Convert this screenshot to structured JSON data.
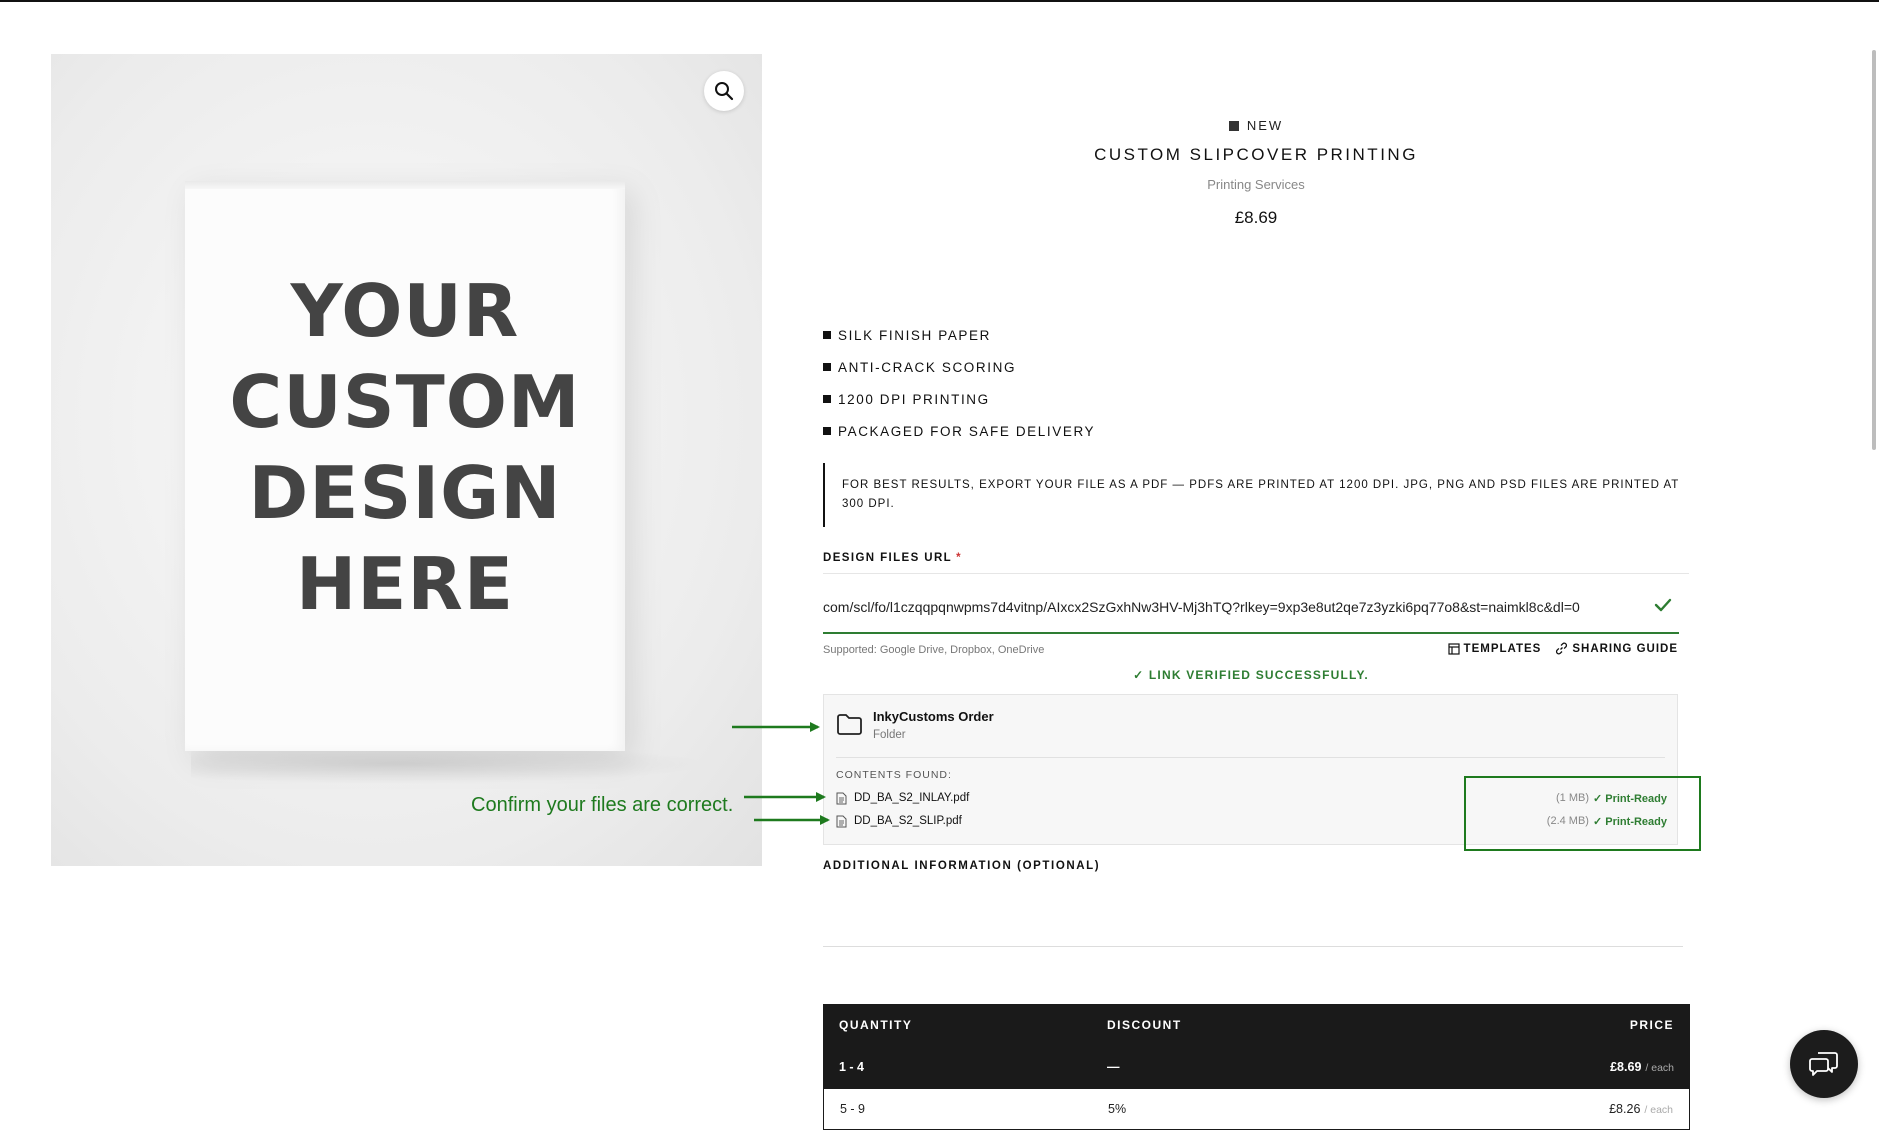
{
  "product": {
    "badge": "NEW",
    "title": "CUSTOM SLIPCOVER PRINTING",
    "category": "Printing Services",
    "price": "£8.69",
    "image_text": [
      "YOUR",
      "CUSTOM",
      "DESIGN",
      "HERE"
    ],
    "features": [
      "SILK FINISH PAPER",
      "ANTI-CRACK SCORING",
      "1200 DPI PRINTING",
      "PACKAGED FOR SAFE DELIVERY"
    ],
    "note": "FOR BEST RESULTS, EXPORT YOUR FILE AS A PDF — PDFS ARE PRINTED AT 1200 DPI. JPG, PNG AND PSD FILES ARE PRINTED AT 300 DPI."
  },
  "design_files": {
    "label": "DESIGN FILES URL",
    "required_mark": "*",
    "value": "com/scl/fo/l1czqqpqnwpms7d4vitnp/AIxcx2SzGxhNw3HV-Mj3hTQ?rlkey=9xp3e8ut2qe7z3yzki6pq77o8&st=naimkl8c&dl=0",
    "supported": "Supported: Google Drive, Dropbox, OneDrive",
    "templates_label": "TEMPLATES",
    "sharing_label": "SHARING GUIDE",
    "verified": "✓ LINK VERIFIED SUCCESSFULLY."
  },
  "folder": {
    "name": "InkyCustoms Order",
    "type": "Folder",
    "contents_label": "CONTENTS FOUND:",
    "files": [
      {
        "name": "DD_BA_S2_INLAY.pdf",
        "size": "(1 MB)",
        "status": "✓ Print-Ready"
      },
      {
        "name": "DD_BA_S2_SLIP.pdf",
        "size": "(2.4 MB)",
        "status": "✓ Print-Ready"
      }
    ]
  },
  "annotation": {
    "text": "Confirm your files are correct.",
    "color": "#1e7a1e"
  },
  "additional": {
    "label": "ADDITIONAL INFORMATION (OPTIONAL)"
  },
  "pricing_table": {
    "headers": [
      "QUANTITY",
      "DISCOUNT",
      "PRICE"
    ],
    "rows": [
      {
        "qty": "1 - 4",
        "discount": "—",
        "price": "£8.69",
        "unit": "/ each"
      },
      {
        "qty": "5 - 9",
        "discount": "5%",
        "price": "£8.26",
        "unit": "/ each"
      }
    ]
  },
  "colors": {
    "success": "#2e7d32",
    "dark": "#1a1a1a",
    "required": "#cc3333"
  },
  "icons": {
    "zoom": "magnifier-icon",
    "chat": "chat-icon",
    "folder": "folder-icon",
    "file": "file-icon",
    "check": "check-icon",
    "templates": "template-icon",
    "link": "link-icon"
  }
}
